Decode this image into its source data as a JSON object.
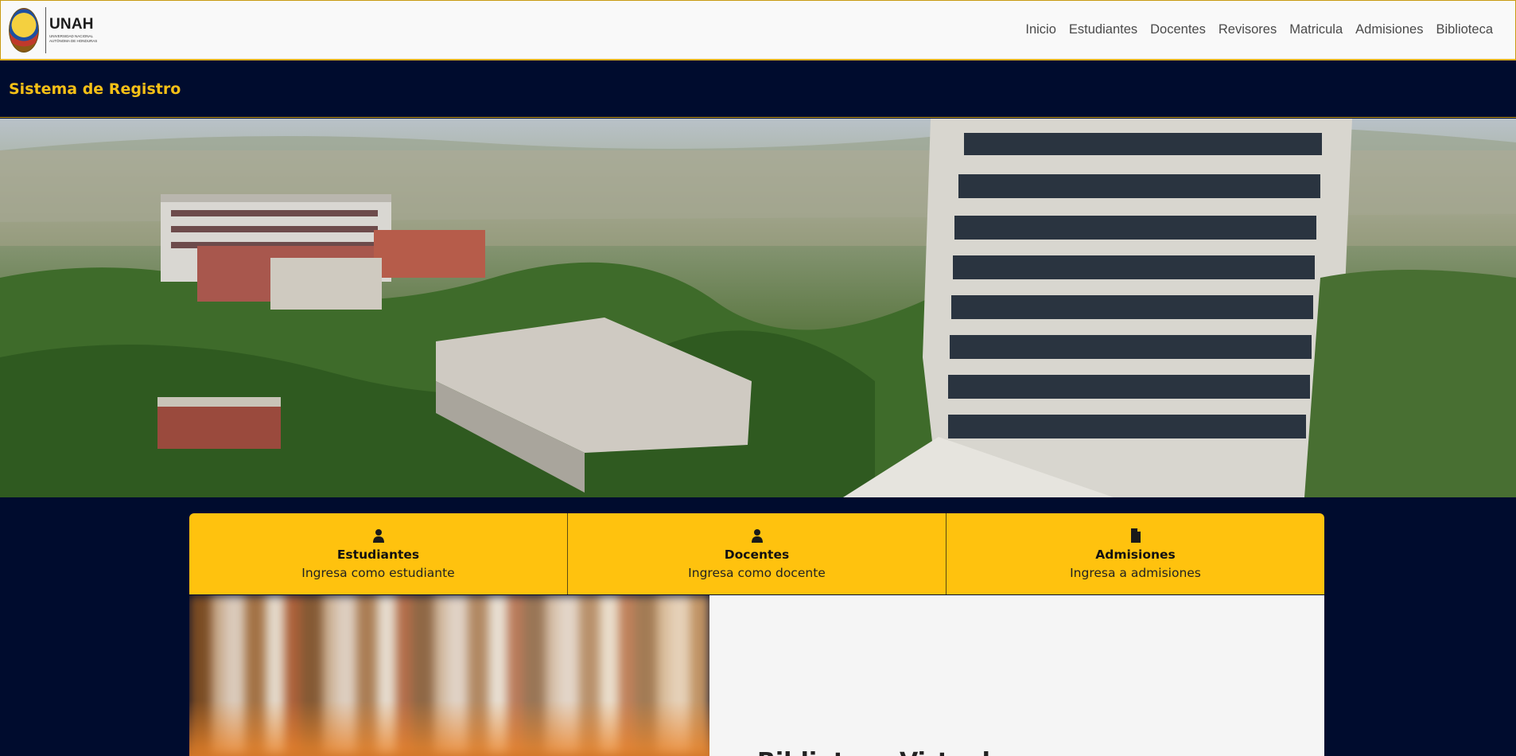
{
  "brand": {
    "name": "UNAH",
    "subtitle_line1": "UNIVERSIDAD NACIONAL",
    "subtitle_line2": "AUTÓNOMA DE HONDURAS",
    "logo_icon": "unah-seal-icon"
  },
  "nav": {
    "items": [
      {
        "label": "Inicio"
      },
      {
        "label": "Estudiantes"
      },
      {
        "label": "Docentes"
      },
      {
        "label": "Revisores"
      },
      {
        "label": "Matricula"
      },
      {
        "label": "Admisiones"
      },
      {
        "label": "Biblioteca"
      }
    ]
  },
  "header": {
    "title": "Sistema de Registro"
  },
  "hero": {
    "description_icon": "campus-photo"
  },
  "cards": [
    {
      "icon": "user-icon",
      "title": "Estudiantes",
      "subtitle": "Ingresa como estudiante"
    },
    {
      "icon": "user-icon",
      "title": "Docentes",
      "subtitle": "Ingresa como docente"
    },
    {
      "icon": "document-icon",
      "title": "Admisiones",
      "subtitle": "Ingresa a admisiones"
    }
  ],
  "library": {
    "heading": "Biblioteca Virtual",
    "image_icon": "bookshelf-photo"
  },
  "colors": {
    "navy": "#000c2e",
    "gold": "#ffc20e",
    "title_gold": "#f5c016",
    "panel": "#f5f5f5"
  }
}
